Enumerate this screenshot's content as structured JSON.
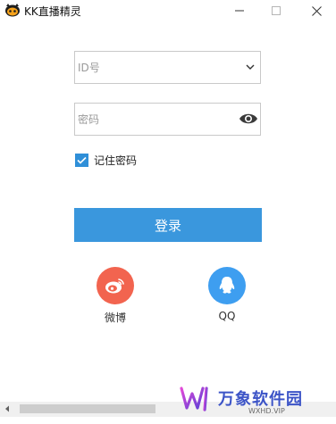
{
  "window": {
    "title": "KK直播精灵"
  },
  "login": {
    "id_placeholder": "ID号",
    "password_placeholder": "密码",
    "remember_label": "记住密码",
    "remember_checked": true,
    "submit_label": "登录"
  },
  "social": {
    "weibo_label": "微博",
    "qq_label": "QQ"
  },
  "watermark": {
    "brand": "万象软件园",
    "url": "WXHD.VIP"
  },
  "colors": {
    "primary": "#3a97dd",
    "checkbox": "#2f8fd8",
    "weibo": "#f2644f",
    "qq": "#3e9ef0",
    "watermark": "#3c54c7"
  },
  "icons": [
    "app-icon",
    "minimize-icon",
    "maximize-icon",
    "close-icon",
    "chevron-down-icon",
    "eye-icon",
    "check-icon",
    "weibo-icon",
    "qq-icon"
  ]
}
